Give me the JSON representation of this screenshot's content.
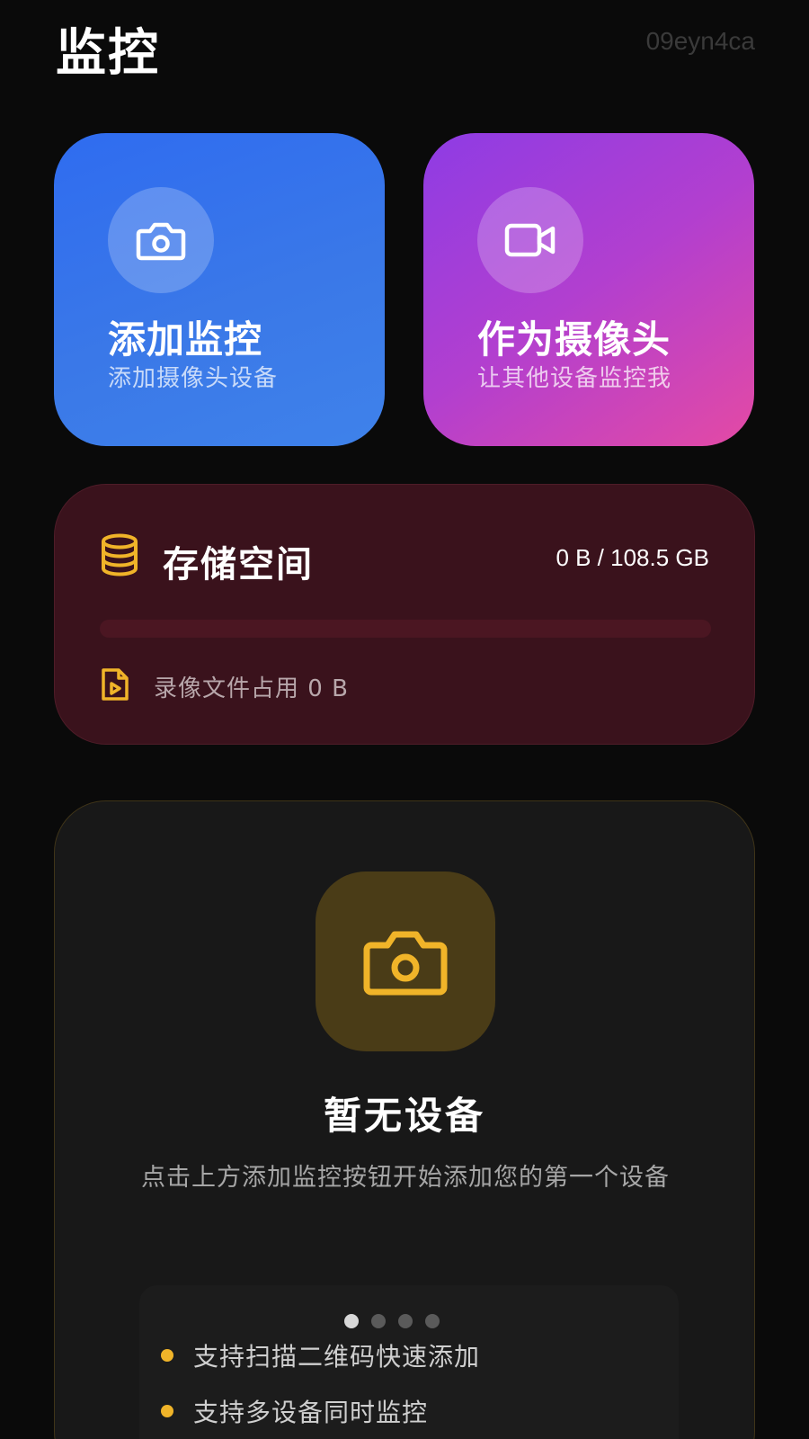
{
  "header": {
    "title": "监控",
    "watermark": "09eyn4ca"
  },
  "action_cards": [
    {
      "title": "添加监控",
      "subtitle": "添加摄像头设备",
      "icon": "camera-icon"
    },
    {
      "title": "作为摄像头",
      "subtitle": "让其他设备监控我",
      "icon": "video-camera-icon"
    }
  ],
  "storage": {
    "title": "存储空间",
    "usage": "0 B / 108.5 GB",
    "used_fraction": 0,
    "recording_label": "录像文件占用 0 B",
    "icon": "database-icon",
    "recording_icon": "video-file-icon"
  },
  "empty_state": {
    "icon": "camera-icon",
    "title": "暂无设备",
    "description": "点击上方添加监控按钮开始添加您的第一个设备",
    "pager_count": 4,
    "pager_active": 0,
    "tips": [
      "支持扫描二维码快速添加",
      "支持多设备同时监控"
    ]
  },
  "colors": {
    "background": "#0a0a0a",
    "accent_gold": "#f0b429",
    "add_card_blue": "#3a78e8",
    "camera_card_purple": "#b23fcf",
    "camera_card_pink": "#e44aa4",
    "storage_card": "#3a121c"
  }
}
